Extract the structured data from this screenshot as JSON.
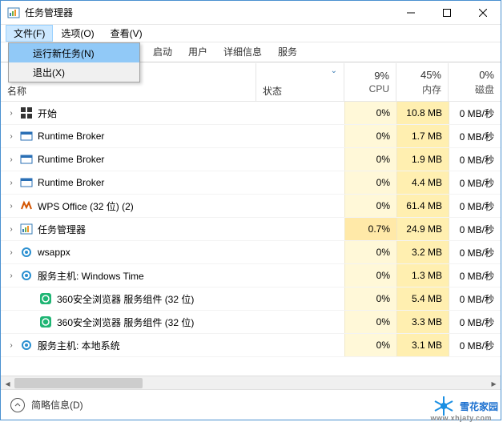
{
  "window": {
    "title": "任务管理器"
  },
  "menubar": {
    "file": "文件(F)",
    "options": "选项(O)",
    "view": "查看(V)"
  },
  "file_menu": {
    "run_new": "运行新任务(N)",
    "exit": "退出(X)"
  },
  "tabs": {
    "startup": "启动",
    "users": "用户",
    "details": "详细信息",
    "services": "服务"
  },
  "columns": {
    "name": "名称",
    "status": "状态",
    "cpu_pct": "9%",
    "cpu_lbl": "CPU",
    "mem_pct": "45%",
    "mem_lbl": "内存",
    "disk_pct": "0%",
    "disk_lbl": "磁盘"
  },
  "rows": [
    {
      "expander": "›",
      "icon": "start",
      "name": "开始",
      "cpu": "0%",
      "mem": "10.8 MB",
      "disk": "0 MB/秒",
      "indent": 0
    },
    {
      "expander": "›",
      "icon": "broker",
      "name": "Runtime Broker",
      "cpu": "0%",
      "mem": "1.7 MB",
      "disk": "0 MB/秒",
      "indent": 0
    },
    {
      "expander": "›",
      "icon": "broker",
      "name": "Runtime Broker",
      "cpu": "0%",
      "mem": "1.9 MB",
      "disk": "0 MB/秒",
      "indent": 0
    },
    {
      "expander": "›",
      "icon": "broker",
      "name": "Runtime Broker",
      "cpu": "0%",
      "mem": "4.4 MB",
      "disk": "0 MB/秒",
      "indent": 0
    },
    {
      "expander": "›",
      "icon": "wps",
      "name": "WPS Office (32 位) (2)",
      "cpu": "0%",
      "mem": "61.4 MB",
      "disk": "0 MB/秒",
      "indent": 0
    },
    {
      "expander": "›",
      "icon": "taskmgr",
      "name": "任务管理器",
      "cpu": "0.7%",
      "mem": "24.9 MB",
      "disk": "0 MB/秒",
      "indent": 0,
      "hot": true
    },
    {
      "expander": "›",
      "icon": "gear",
      "name": "wsappx",
      "cpu": "0%",
      "mem": "3.2 MB",
      "disk": "0 MB/秒",
      "indent": 0
    },
    {
      "expander": "›",
      "icon": "gear",
      "name": "服务主机: Windows Time",
      "cpu": "0%",
      "mem": "1.3 MB",
      "disk": "0 MB/秒",
      "indent": 0
    },
    {
      "expander": "",
      "icon": "360",
      "name": "360安全浏览器 服务组件 (32 位)",
      "cpu": "0%",
      "mem": "5.4 MB",
      "disk": "0 MB/秒",
      "indent": 1
    },
    {
      "expander": "",
      "icon": "360",
      "name": "360安全浏览器 服务组件 (32 位)",
      "cpu": "0%",
      "mem": "3.3 MB",
      "disk": "0 MB/秒",
      "indent": 1
    },
    {
      "expander": "›",
      "icon": "gear",
      "name": "服务主机: 本地系统",
      "cpu": "0%",
      "mem": "3.1 MB",
      "disk": "0 MB/秒",
      "indent": 0
    }
  ],
  "footer": {
    "less_details": "简略信息(D)"
  },
  "watermark": {
    "text": "雪花家园",
    "sub": "www.xhjaty.com"
  }
}
